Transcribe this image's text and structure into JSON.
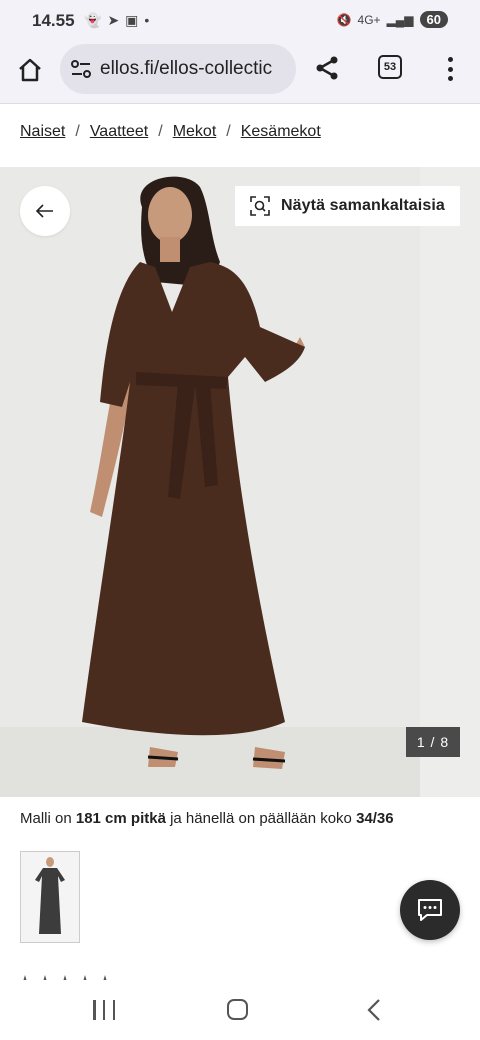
{
  "status": {
    "time": "14.55",
    "network": "4G+",
    "battery": "60"
  },
  "browser": {
    "url": "ellos.fi/ellos-collectic",
    "tab_count": "53"
  },
  "breadcrumb": [
    {
      "label": "Naiset"
    },
    {
      "label": "Vaatteet"
    },
    {
      "label": "Mekot"
    },
    {
      "label": "Kesämekot"
    }
  ],
  "breadcrumb_separator": "/",
  "gallery": {
    "similar_label": "Näytä samankaltaisia",
    "counter": "1 / 8"
  },
  "model_info": {
    "prefix": "Malli on",
    "height": "181 cm pitkä",
    "middle": "ja hänellä on päällään koko",
    "size": "34/36"
  },
  "colors": {
    "dress": "#4a2c1f",
    "background": "#e9e9e7",
    "fab": "#2b2b2b"
  }
}
